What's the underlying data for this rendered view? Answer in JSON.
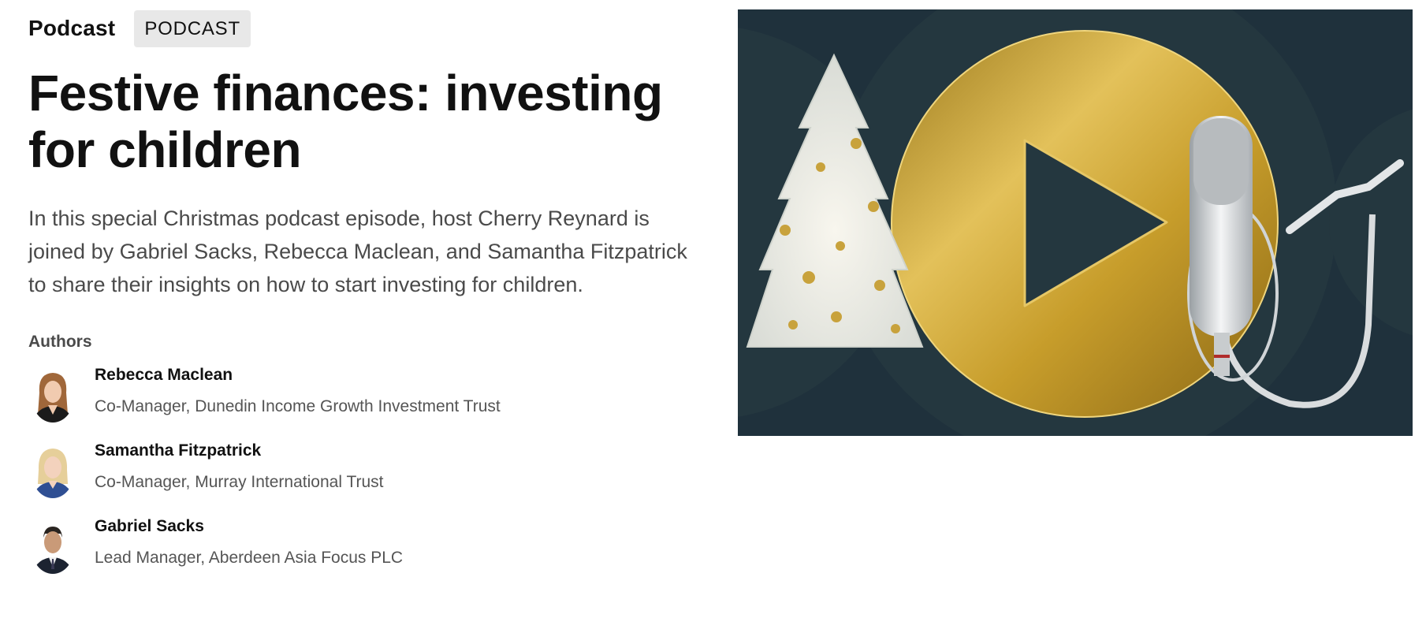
{
  "header": {
    "kicker": "Podcast",
    "badge": "PODCAST"
  },
  "article": {
    "title": "Festive finances: investing for children",
    "description": "In this special Christmas podcast episode, host Cherry Reynard is joined by Gabriel Sacks, Rebecca Maclean, and Samantha Fitzpatrick to share their insights on how to start investing for children.",
    "authors_label": "Authors",
    "authors": [
      {
        "name": "Rebecca Maclean",
        "role": "Co-Manager, Dunedin Income Growth Investment Trust"
      },
      {
        "name": "Samantha Fitzpatrick",
        "role": "Co-Manager, Murray International Trust"
      },
      {
        "name": "Gabriel Sacks",
        "role": "Lead Manager, Aberdeen Asia Focus PLC"
      }
    ]
  },
  "colors": {
    "hero_bg": "#1f313c",
    "gold": "#c9a227",
    "play_shape": "#24373f"
  },
  "icons": {
    "hero_play": "play-icon",
    "hero_mic": "microphone-icon",
    "hero_tree": "christmas-tree-icon"
  }
}
